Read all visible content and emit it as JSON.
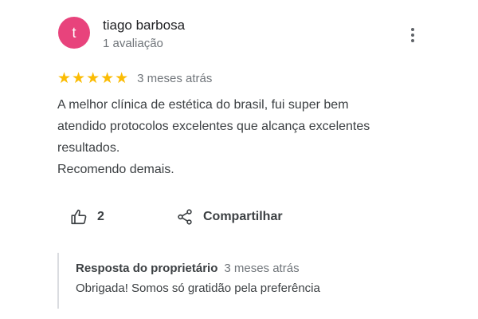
{
  "reviewer": {
    "initial": "t",
    "name": "tiago barbosa",
    "review_count": "1 avaliação",
    "avatar_color": "#e8437c"
  },
  "review": {
    "stars_display": "★★★★★",
    "rating": 5,
    "date": "3 meses atrás",
    "text": "A melhor clínica de estética do brasil, fui super bem\natendido protocolos excelentes que alcança excelentes\nresultados.\nRecomendo demais."
  },
  "actions": {
    "like_count": "2",
    "share_label": "Compartilhar"
  },
  "owner_reply": {
    "title": "Resposta do proprietário",
    "date": "3 meses atrás",
    "text": "Obrigada! Somos só gratidão pela preferência"
  },
  "colors": {
    "star": "#fbbc04",
    "secondary_text": "#70757a",
    "body_text": "#3c4043",
    "reply_border": "#dadce0"
  },
  "icons": {
    "more": "more-vert-icon",
    "like": "thumb-up-icon",
    "share": "share-icon"
  }
}
